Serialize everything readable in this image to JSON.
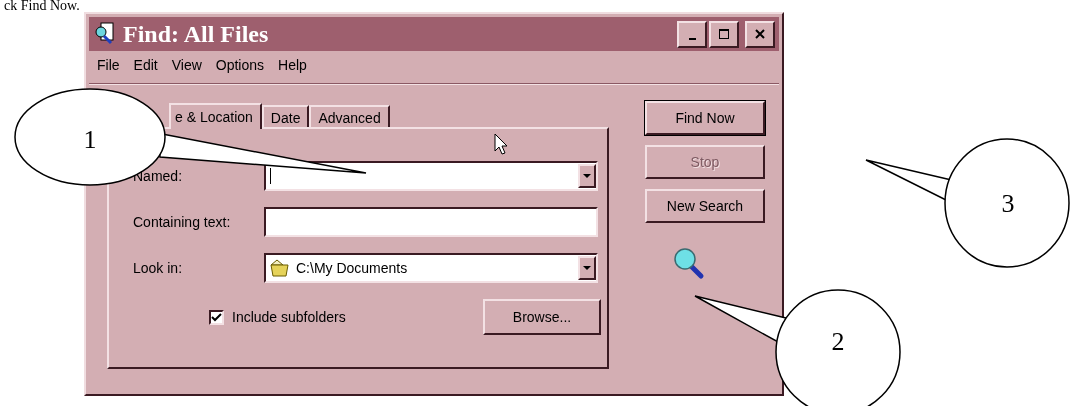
{
  "page_text": "ck Find Now.",
  "window": {
    "title": "Find: All Files"
  },
  "menu": [
    "File",
    "Edit",
    "View",
    "Options",
    "Help"
  ],
  "tabs": [
    {
      "label": "e & Location",
      "selected": true
    },
    {
      "label": "Date",
      "selected": false
    },
    {
      "label": "Advanced",
      "selected": false
    }
  ],
  "fields": [
    {
      "label": "Named:",
      "kind": "combo",
      "focused": true
    },
    {
      "label": "Containing text:",
      "kind": "text",
      "focused": false
    },
    {
      "label": "Look in:",
      "kind": "folder-combo",
      "value": "C:\\My Documents",
      "focused": false
    }
  ],
  "include_subfolders": {
    "label": "Include subfolders",
    "checked": true
  },
  "browse_button": "Browse...",
  "buttons": [
    {
      "label": "Find Now",
      "disabled": false
    },
    {
      "label": "Stop",
      "disabled": true
    },
    {
      "label": "New Search",
      "disabled": false
    }
  ],
  "callouts": [
    {
      "number": "1"
    },
    {
      "number": "2"
    },
    {
      "number": "3"
    }
  ]
}
